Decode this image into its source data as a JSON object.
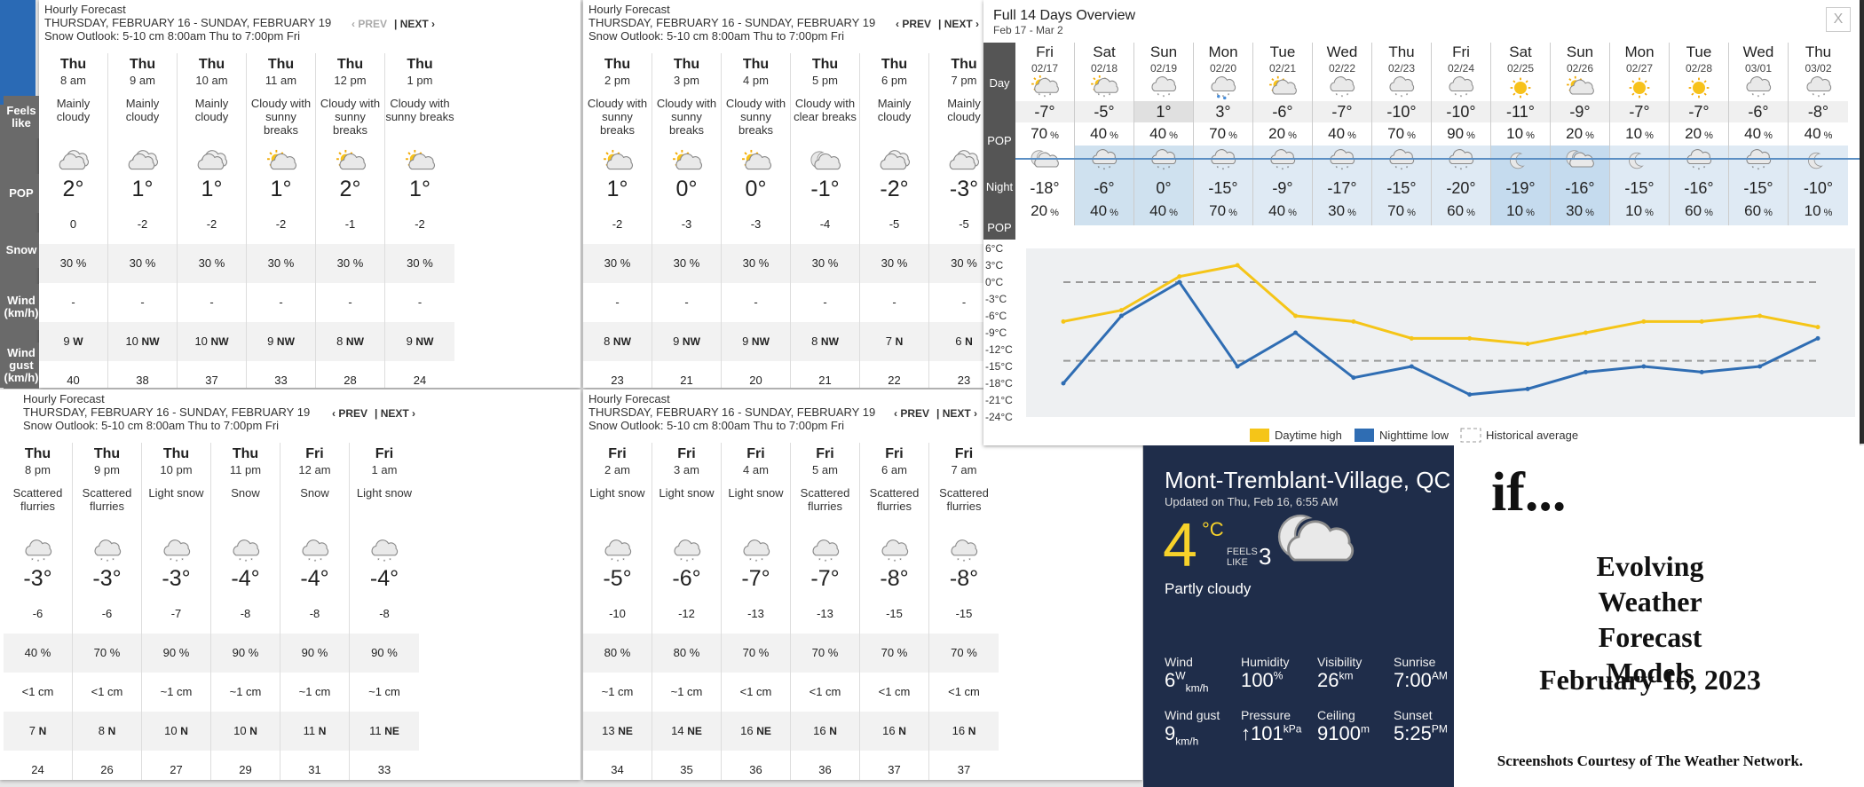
{
  "hourly": {
    "title": "Hourly Forecast",
    "range": "THURSDAY, FEBRUARY 16 - SUNDAY, FEBRUARY 19",
    "outlook": "Snow Outlook: 5-10 cm 8:00am Thu to 7:00pm Fri",
    "prev": "‹ PREV",
    "next": "NEXT ›",
    "labels": {
      "feels": "Feels like",
      "pop": "POP",
      "snow": "Snow",
      "wind": "Wind (km/h)",
      "gust": "Wind gust (km/h)"
    },
    "panels": [
      {
        "cols": [
          {
            "day": "Thu",
            "time": "8 am",
            "cond": "Mainly cloudy",
            "icon": "cloudy",
            "temp": "2°",
            "feels": "0",
            "pop": "30 %",
            "snow": "-",
            "ws": "9",
            "wd": "W",
            "gust": "40"
          },
          {
            "day": "Thu",
            "time": "9 am",
            "cond": "Mainly cloudy",
            "icon": "cloudy",
            "temp": "1°",
            "feels": "-2",
            "pop": "30 %",
            "snow": "-",
            "ws": "10",
            "wd": "NW",
            "gust": "38"
          },
          {
            "day": "Thu",
            "time": "10 am",
            "cond": "Mainly cloudy",
            "icon": "cloudy",
            "temp": "1°",
            "feels": "-2",
            "pop": "30 %",
            "snow": "-",
            "ws": "10",
            "wd": "NW",
            "gust": "37"
          },
          {
            "day": "Thu",
            "time": "11 am",
            "cond": "Cloudy with sunny breaks",
            "icon": "sun-cloud",
            "temp": "1°",
            "feels": "-2",
            "pop": "30 %",
            "snow": "-",
            "ws": "9",
            "wd": "NW",
            "gust": "33"
          },
          {
            "day": "Thu",
            "time": "12 pm",
            "cond": "Cloudy with sunny breaks",
            "icon": "sun-cloud",
            "temp": "2°",
            "feels": "-1",
            "pop": "30 %",
            "snow": "-",
            "ws": "8",
            "wd": "NW",
            "gust": "28"
          },
          {
            "day": "Thu",
            "time": "1 pm",
            "cond": "Cloudy with sunny breaks",
            "icon": "sun-cloud",
            "temp": "1°",
            "feels": "-2",
            "pop": "30 %",
            "snow": "-",
            "ws": "9",
            "wd": "NW",
            "gust": "24"
          }
        ]
      },
      {
        "cols": [
          {
            "day": "Thu",
            "time": "2 pm",
            "cond": "Cloudy with sunny breaks",
            "icon": "sun-cloud",
            "temp": "1°",
            "feels": "-2",
            "pop": "30 %",
            "snow": "-",
            "ws": "8",
            "wd": "NW",
            "gust": "23"
          },
          {
            "day": "Thu",
            "time": "3 pm",
            "cond": "Cloudy with sunny breaks",
            "icon": "sun-cloud",
            "temp": "0°",
            "feels": "-3",
            "pop": "30 %",
            "snow": "-",
            "ws": "9",
            "wd": "NW",
            "gust": "21"
          },
          {
            "day": "Thu",
            "time": "4 pm",
            "cond": "Cloudy with sunny breaks",
            "icon": "sun-cloud",
            "temp": "0°",
            "feels": "-3",
            "pop": "30 %",
            "snow": "-",
            "ws": "9",
            "wd": "NW",
            "gust": "20"
          },
          {
            "day": "Thu",
            "time": "5 pm",
            "cond": "Cloudy with clear breaks",
            "icon": "moon-cloud",
            "temp": "-1°",
            "feels": "-4",
            "pop": "30 %",
            "snow": "-",
            "ws": "8",
            "wd": "NW",
            "gust": "21"
          },
          {
            "day": "Thu",
            "time": "6 pm",
            "cond": "Mainly cloudy",
            "icon": "cloudy",
            "temp": "-2°",
            "feels": "-5",
            "pop": "30 %",
            "snow": "-",
            "ws": "7",
            "wd": "N",
            "gust": "22"
          },
          {
            "day": "Thu",
            "time": "7 pm",
            "cond": "Mainly cloudy",
            "icon": "cloudy",
            "temp": "-3°",
            "feels": "-5",
            "pop": "30 %",
            "snow": "-",
            "ws": "6",
            "wd": "N",
            "gust": "23"
          }
        ]
      },
      {
        "cols": [
          {
            "day": "Thu",
            "time": "8 pm",
            "cond": "Scattered flurries",
            "icon": "snow",
            "temp": "-3°",
            "feels": "-6",
            "pop": "40 %",
            "snow": "<1 cm",
            "ws": "7",
            "wd": "N",
            "gust": "24"
          },
          {
            "day": "Thu",
            "time": "9 pm",
            "cond": "Scattered flurries",
            "icon": "snow",
            "temp": "-3°",
            "feels": "-6",
            "pop": "70 %",
            "snow": "<1 cm",
            "ws": "8",
            "wd": "N",
            "gust": "26"
          },
          {
            "day": "Thu",
            "time": "10 pm",
            "cond": "Light snow",
            "icon": "snow",
            "temp": "-3°",
            "feels": "-7",
            "pop": "90 %",
            "snow": "~1 cm",
            "ws": "10",
            "wd": "N",
            "gust": "27"
          },
          {
            "day": "Thu",
            "time": "11 pm",
            "cond": "Snow",
            "icon": "snow",
            "temp": "-4°",
            "feels": "-8",
            "pop": "90 %",
            "snow": "~1 cm",
            "ws": "10",
            "wd": "N",
            "gust": "29"
          },
          {
            "day": "Fri",
            "time": "12 am",
            "cond": "Snow",
            "icon": "snow",
            "temp": "-4°",
            "feels": "-8",
            "pop": "90 %",
            "snow": "~1 cm",
            "ws": "11",
            "wd": "N",
            "gust": "31"
          },
          {
            "day": "Fri",
            "time": "1 am",
            "cond": "Light snow",
            "icon": "snow",
            "temp": "-4°",
            "feels": "-8",
            "pop": "90 %",
            "snow": "~1 cm",
            "ws": "11",
            "wd": "NE",
            "gust": "33"
          }
        ]
      },
      {
        "cols": [
          {
            "day": "Fri",
            "time": "2 am",
            "cond": "Light snow",
            "icon": "snow",
            "temp": "-5°",
            "feels": "-10",
            "pop": "80 %",
            "snow": "~1 cm",
            "ws": "13",
            "wd": "NE",
            "gust": "34"
          },
          {
            "day": "Fri",
            "time": "3 am",
            "cond": "Light snow",
            "icon": "snow",
            "temp": "-6°",
            "feels": "-12",
            "pop": "80 %",
            "snow": "~1 cm",
            "ws": "14",
            "wd": "NE",
            "gust": "35"
          },
          {
            "day": "Fri",
            "time": "4 am",
            "cond": "Light snow",
            "icon": "snow",
            "temp": "-7°",
            "feels": "-13",
            "pop": "70 %",
            "snow": "<1 cm",
            "ws": "16",
            "wd": "NE",
            "gust": "36"
          },
          {
            "day": "Fri",
            "time": "5 am",
            "cond": "Scattered flurries",
            "icon": "snow",
            "temp": "-7°",
            "feels": "-13",
            "pop": "70 %",
            "snow": "<1 cm",
            "ws": "16",
            "wd": "N",
            "gust": "36"
          },
          {
            "day": "Fri",
            "time": "6 am",
            "cond": "Scattered flurries",
            "icon": "snow",
            "temp": "-8°",
            "feels": "-15",
            "pop": "70 %",
            "snow": "<1 cm",
            "ws": "16",
            "wd": "N",
            "gust": "37"
          },
          {
            "day": "Fri",
            "time": "7 am",
            "cond": "Scattered flurries",
            "icon": "snow",
            "temp": "-8°",
            "feels": "-15",
            "pop": "70 %",
            "snow": "<1 cm",
            "ws": "16",
            "wd": "N",
            "gust": "37"
          }
        ]
      }
    ]
  },
  "overview": {
    "title": "Full 14 Days Overview",
    "subtitle": "Feb 17 - Mar 2",
    "close": "X",
    "labels": {
      "day": "Day",
      "pop": "POP",
      "night": "Night",
      "pop2": "POP"
    },
    "days": [
      {
        "dow": "Fri",
        "date": "02/17",
        "dicon": "sun-snow",
        "dt": "-7°",
        "dp": "70",
        "nicon": "moon-cloud",
        "nt": "-18°",
        "np": "20"
      },
      {
        "dow": "Sat",
        "date": "02/18",
        "dicon": "sun-snow",
        "dt": "-5°",
        "dp": "40",
        "nicon": "snow",
        "nt": "-6°",
        "np": "40"
      },
      {
        "dow": "Sun",
        "date": "02/19",
        "dicon": "snow",
        "dt": "1°",
        "dp": "40",
        "nicon": "snow",
        "nt": "0°",
        "np": "40"
      },
      {
        "dow": "Mon",
        "date": "02/20",
        "dicon": "rain-snow",
        "dt": "3°",
        "dp": "70",
        "nicon": "snow",
        "nt": "-15°",
        "np": "70"
      },
      {
        "dow": "Tue",
        "date": "02/21",
        "dicon": "sun-cloud",
        "dt": "-6°",
        "dp": "20",
        "nicon": "snow",
        "nt": "-9°",
        "np": "40"
      },
      {
        "dow": "Wed",
        "date": "02/22",
        "dicon": "snow",
        "dt": "-7°",
        "dp": "40",
        "nicon": "snow",
        "nt": "-17°",
        "np": "30"
      },
      {
        "dow": "Thu",
        "date": "02/23",
        "dicon": "snow",
        "dt": "-10°",
        "dp": "70",
        "nicon": "snow",
        "nt": "-15°",
        "np": "70"
      },
      {
        "dow": "Fri",
        "date": "02/24",
        "dicon": "snow",
        "dt": "-10°",
        "dp": "90",
        "nicon": "snow",
        "nt": "-20°",
        "np": "60"
      },
      {
        "dow": "Sat",
        "date": "02/25",
        "dicon": "sun",
        "dt": "-11°",
        "dp": "10",
        "nicon": "moon",
        "nt": "-19°",
        "np": "10"
      },
      {
        "dow": "Sun",
        "date": "02/26",
        "dicon": "sun-cloud",
        "dt": "-9°",
        "dp": "20",
        "nicon": "moon-cloud",
        "nt": "-16°",
        "np": "30"
      },
      {
        "dow": "Mon",
        "date": "02/27",
        "dicon": "sun",
        "dt": "-7°",
        "dp": "10",
        "nicon": "moon",
        "nt": "-15°",
        "np": "10"
      },
      {
        "dow": "Tue",
        "date": "02/28",
        "dicon": "sun",
        "dt": "-7°",
        "dp": "20",
        "nicon": "snow",
        "nt": "-16°",
        "np": "60"
      },
      {
        "dow": "Wed",
        "date": "03/01",
        "dicon": "snow",
        "dt": "-6°",
        "dp": "40",
        "nicon": "snow",
        "nt": "-15°",
        "np": "60"
      },
      {
        "dow": "Thu",
        "date": "03/02",
        "dicon": "snow",
        "dt": "-8°",
        "dp": "40",
        "nicon": "moon",
        "nt": "-10°",
        "np": "10"
      }
    ]
  },
  "chart_data": {
    "type": "line",
    "categories": [
      "02/17",
      "02/18",
      "02/19",
      "02/20",
      "02/21",
      "02/22",
      "02/23",
      "02/24",
      "02/25",
      "02/26",
      "02/27",
      "02/28",
      "03/01",
      "03/02"
    ],
    "series": [
      {
        "name": "Daytime high",
        "color": "#f5c518",
        "values": [
          -7,
          -5,
          1,
          3,
          -6,
          -7,
          -10,
          -10,
          -11,
          -9,
          -7,
          -7,
          -6,
          -8
        ]
      },
      {
        "name": "Nighttime low",
        "color": "#2f6db3",
        "values": [
          -18,
          -6,
          0,
          -15,
          -9,
          -17,
          -15,
          -20,
          -19,
          -16,
          -15,
          -16,
          -15,
          -10
        ]
      }
    ],
    "historical": {
      "name": "Historical average",
      "high": 0,
      "low": -14
    },
    "yticks": [
      "6°C",
      "3°C",
      "0°C",
      "-3°C",
      "-6°C",
      "-9°C",
      "-12°C",
      "-15°C",
      "-18°C",
      "-21°C",
      "-24°C"
    ],
    "ylim": [
      -24,
      6
    ],
    "legend": "bottom"
  },
  "current": {
    "location": "Mont-Tremblant-Village, QC",
    "updated": "Updated on Thu, Feb 16, 6:55 AM",
    "temp": "4",
    "unit": "°C",
    "feels_label": "FEELS LIKE",
    "feels": "3",
    "condition": "Partly cloudy",
    "stats": [
      {
        "label": "Wind",
        "value": "6",
        "sup": "W",
        "sub": "km/h"
      },
      {
        "label": "Humidity",
        "value": "100",
        "sup": "%",
        "sub": ""
      },
      {
        "label": "Visibility",
        "value": "26",
        "sup": "km",
        "sub": ""
      },
      {
        "label": "Sunrise",
        "value": "7:00",
        "sup": "AM",
        "sub": ""
      },
      {
        "label": "Wind gust",
        "value": "9",
        "sup": "",
        "sub": "km/h"
      },
      {
        "label": "Pressure",
        "value": "↑101",
        "sup": "kPa",
        "sub": ""
      },
      {
        "label": "Ceiling",
        "value": "9100",
        "sup": "m",
        "sub": ""
      },
      {
        "label": "Sunset",
        "value": "5:25",
        "sup": "PM",
        "sub": ""
      }
    ]
  },
  "promo": {
    "if": "if...",
    "title": "Evolving Weather Forecast Models",
    "date": "February 16, 2023",
    "credit": "Screenshots Courtesy of The Weather Network."
  }
}
